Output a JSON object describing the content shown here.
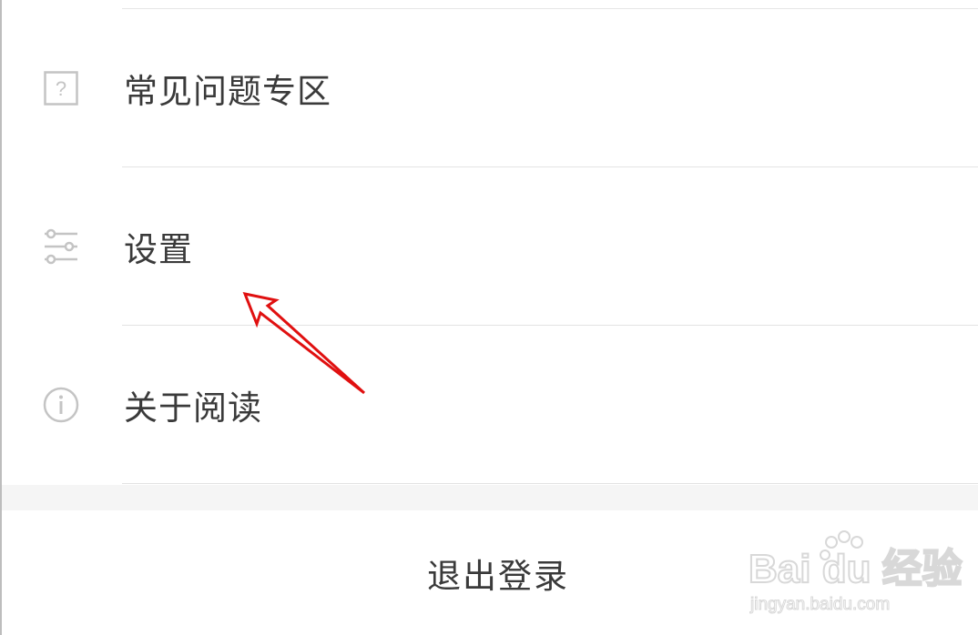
{
  "menu": {
    "items": [
      {
        "label": "常见问题专区",
        "icon": "help-square-icon"
      },
      {
        "label": "设置",
        "icon": "sliders-icon"
      },
      {
        "label": "关于阅读",
        "icon": "info-circle-icon"
      }
    ]
  },
  "logout": {
    "label": "退出登录"
  },
  "watermark": {
    "brand": "Bai du 经验",
    "url": "jingyan.baidu.com"
  },
  "colors": {
    "text": "#3a3a3a",
    "icon": "#c4c4c4",
    "divider": "#e3e3e3",
    "band": "#f5f5f5",
    "annotation": "#e01010"
  }
}
